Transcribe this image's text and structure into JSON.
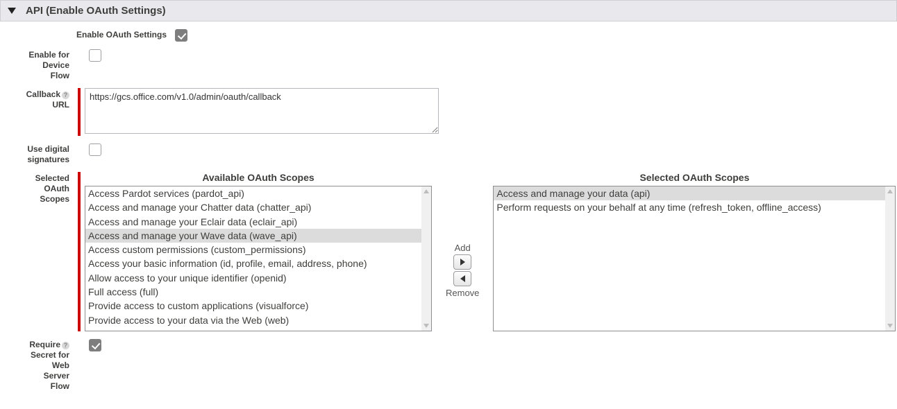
{
  "section": {
    "title": "API (Enable OAuth Settings)"
  },
  "labels": {
    "enable_oauth": "Enable OAuth Settings",
    "enable_device_flow_l1": "Enable for",
    "enable_device_flow_l2": "Device",
    "enable_device_flow_l3": "Flow",
    "callback_l1": "Callback",
    "callback_l2": "URL",
    "digital_sig_l1": "Use digital",
    "digital_sig_l2": "signatures",
    "selected_scopes_l1": "Selected",
    "selected_scopes_l2": "OAuth",
    "selected_scopes_l3": "Scopes",
    "require_secret_l1": "Require",
    "require_secret_l2": "Secret for",
    "require_secret_l3": "Web",
    "require_secret_l4": "Server",
    "require_secret_l5": "Flow"
  },
  "values": {
    "callback_url": "https://gcs.office.com/v1.0/admin/oauth/callback"
  },
  "scopes": {
    "available_heading": "Available OAuth Scopes",
    "selected_heading": "Selected OAuth Scopes",
    "add_label": "Add",
    "remove_label": "Remove",
    "available": [
      "Access Pardot services (pardot_api)",
      "Access and manage your Chatter data (chatter_api)",
      "Access and manage your Eclair data (eclair_api)",
      "Access and manage your Wave data (wave_api)",
      "Access custom permissions (custom_permissions)",
      "Access your basic information (id, profile, email, address, phone)",
      "Allow access to your unique identifier (openid)",
      "Full access (full)",
      "Provide access to custom applications (visualforce)",
      "Provide access to your data via the Web (web)"
    ],
    "available_highlight_index": 3,
    "selected": [
      "Access and manage your data (api)",
      "Perform requests on your behalf at any time (refresh_token, offline_access)"
    ],
    "selected_highlight_index": 0
  }
}
